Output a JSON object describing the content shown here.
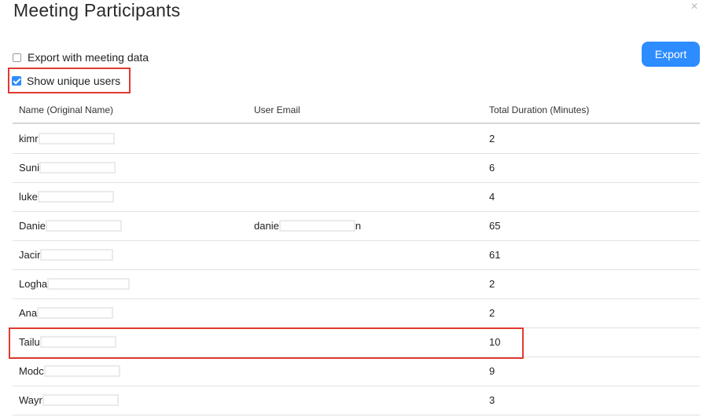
{
  "dialog": {
    "title": "Meeting Participants",
    "close_glyph": "×",
    "export_with_meeting_data": {
      "label": "Export with meeting data",
      "checked": false
    },
    "show_unique_users": {
      "label": "Show unique users",
      "checked": true
    },
    "export_label": "Export"
  },
  "table": {
    "columns": [
      "Name (Original Name)",
      "User Email",
      "Total Duration (Minutes)"
    ],
    "rows": [
      {
        "name": "kimr",
        "email": "",
        "duration": "2"
      },
      {
        "name": "Suni",
        "email": "",
        "duration": "6"
      },
      {
        "name": "luke",
        "email": "",
        "duration": "4"
      },
      {
        "name": "Danie",
        "email": "danie",
        "email_tail": "n",
        "duration": "65"
      },
      {
        "name": "Jacir",
        "email": "",
        "duration": "61"
      },
      {
        "name": "Logha",
        "email": "",
        "duration": "2"
      },
      {
        "name": "Ana",
        "email": "",
        "duration": "2"
      },
      {
        "name": "Tailu",
        "email": "",
        "duration": "10"
      },
      {
        "name": "Modc",
        "email": "",
        "duration": "9"
      },
      {
        "name": "Wayr",
        "email": "",
        "duration": "3"
      }
    ]
  },
  "colors": {
    "accent": "#2d8cff",
    "highlight": "#e03a31"
  }
}
